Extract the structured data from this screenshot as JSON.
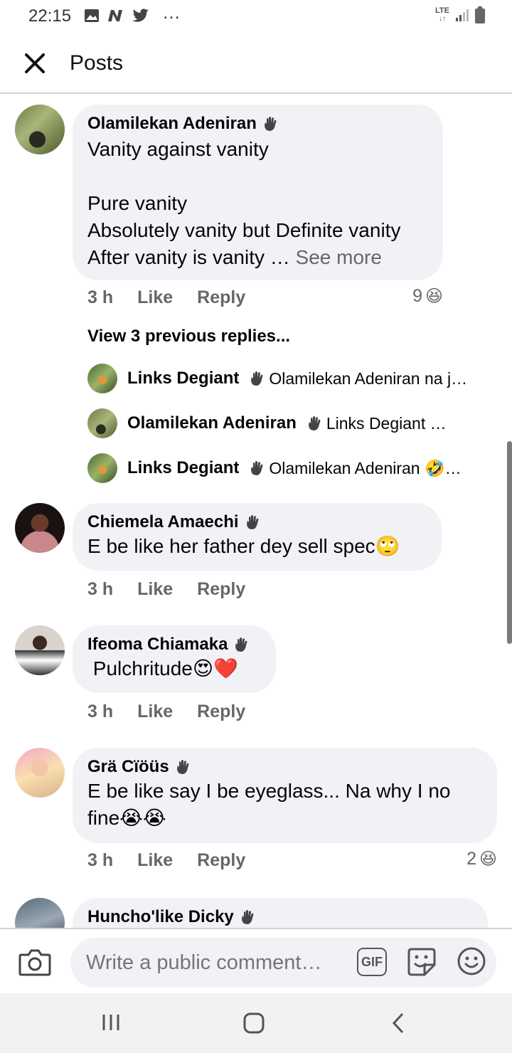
{
  "status": {
    "time": "22:15",
    "overflow": "…",
    "network": "LTE",
    "icons_left": [
      "image-icon",
      "n-icon",
      "twitter-icon"
    ]
  },
  "topbar": {
    "title": "Posts",
    "close_icon": "close-icon"
  },
  "comments": [
    {
      "author": "Olamilekan Adeniran",
      "text": "Vanity against vanity\n\nPure vanity\nAbsolutely vanity but Definite vanity\nAfter vanity is vanity …",
      "see_more": "See more",
      "time": "3 h",
      "like": "Like",
      "reply": "Reply",
      "reaction_count": "9",
      "reaction_emoji": "😆"
    },
    {
      "author": "Chiemela Amaechi",
      "text": "E be like her father dey sell spec🙄",
      "time": "3 h",
      "like": "Like",
      "reply": "Reply"
    },
    {
      "author": "Ifeoma Chiamaka",
      "text": " Pulchritude😍❤️",
      "time": "3 h",
      "like": "Like",
      "reply": "Reply"
    },
    {
      "author": "Grä Cïöüs",
      "text": "E be like say I be eyeglass... Na why I no fine😭😭",
      "time": "3 h",
      "like": "Like",
      "reply": "Reply",
      "reaction_count": "2",
      "reaction_emoji": "😆"
    },
    {
      "author": "Huncho'like Dicky"
    }
  ],
  "view_previous": "View 3 previous replies...",
  "replies": [
    {
      "author": "Links Degiant",
      "text": "Olamilekan Adeniran na j…"
    },
    {
      "author": "Olamilekan Adeniran",
      "text": "Links Degiant …"
    },
    {
      "author": "Links Degiant",
      "text": "Olamilekan Adeniran 🤣…"
    }
  ],
  "composer": {
    "placeholder": "Write a public comment…",
    "gif_label": "GIF"
  },
  "colors": {
    "bubble": "#f0f2f5",
    "secondary_text": "#65676b",
    "divider": "#d0d3d7"
  }
}
